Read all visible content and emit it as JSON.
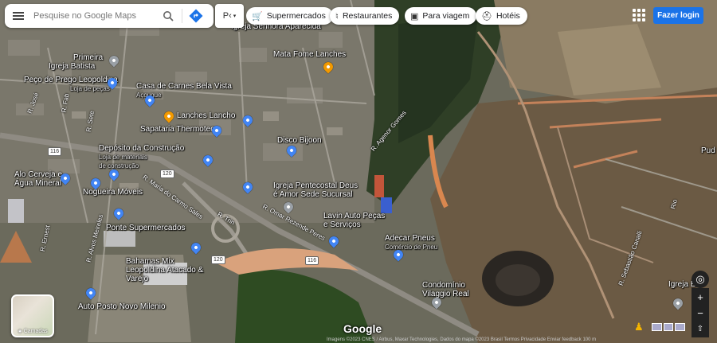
{
  "search": {
    "placeholder": "Pesquise no Google Maps"
  },
  "layer_select": {
    "label": "P‹"
  },
  "chips": [
    {
      "icon": "cart-icon",
      "label": "Supermercados"
    },
    {
      "icon": "fork-knife-icon",
      "label": "Restaurantes"
    },
    {
      "icon": "suitcase-icon",
      "label": "Para viagem"
    },
    {
      "icon": "bed-icon",
      "label": "Hotéis"
    }
  ],
  "header": {
    "login_label": "Fazer login"
  },
  "layers": {
    "label": "Camadas"
  },
  "places": [
    {
      "name": "Igreja Batista",
      "sub": "",
      "pin": "gray"
    },
    {
      "name": "Primeira",
      "sub": "",
      "pin": ""
    },
    {
      "name": "Peço de Prego Leopoldina",
      "sub": "Loja de peças",
      "pin": "blue"
    },
    {
      "name": "Casa de Carnes Bela Vista",
      "sub": "Açougue",
      "pin": "blue"
    },
    {
      "name": "Lanches Lancho",
      "sub": "",
      "pin": "orange"
    },
    {
      "name": "Sapataria Thermoteo",
      "sub": "",
      "pin": "blue"
    },
    {
      "name": "Mata Fome Lanches",
      "sub": "",
      "pin": "orange"
    },
    {
      "name": "Disco Bijoon",
      "sub": "",
      "pin": "blue"
    },
    {
      "name": "Depósito da Construção",
      "sub": "Loja de materiais de construção",
      "pin": "blue"
    },
    {
      "name": "Alo Cerveja e Água Mineral",
      "sub": "",
      "pin": "blue"
    },
    {
      "name": "Nogueira Móveis",
      "sub": "",
      "pin": "blue"
    },
    {
      "name": "Ponte Supermercados",
      "sub": "",
      "pin": "blue"
    },
    {
      "name": "Igreja Pentecostal Deus é Amor Sede Sucursal",
      "sub": "",
      "pin": "gray"
    },
    {
      "name": "Lavin Auto Peças e Serviços",
      "sub": "",
      "pin": "blue"
    },
    {
      "name": "Adecar Pneus",
      "sub": "Comércio de Pneu",
      "pin": "blue"
    },
    {
      "name": "Bahamas Mix Leopoldina Atacado & Varejo",
      "sub": "",
      "pin": "blue"
    },
    {
      "name": "Condomínio Vilaggio Real",
      "sub": "",
      "pin": "gray"
    },
    {
      "name": "Auto Posto Novo Milenio",
      "sub": "",
      "pin": "blue"
    },
    {
      "name": "Igreja Senhora Aparecida",
      "sub": "",
      "pin": "gray"
    },
    {
      "name": "Pud",
      "sub": "",
      "pin": ""
    },
    {
      "name": "Igreja E",
      "sub": "",
      "pin": ""
    }
  ],
  "shields": [
    "116",
    "120",
    "120",
    "116"
  ],
  "streets": [
    "R. Maria do Carmo Sales",
    "R. Omar Rezende Peres",
    "R. Agenor Gomes",
    "R. Alvos Meireles",
    "R. Trin",
    "R. José",
    "R. Fab",
    "R. Ernest",
    "R. Sebastião Canalli",
    "Rio",
    "R. Sete"
  ],
  "footer": {
    "logo": "Google",
    "attribution": "Imagens ©2023 CNES / Airbus, Maxar Technologies, Dados do mapa ©2023  Brasil  Termos  Privacidade  Enviar feedback  100 m"
  },
  "colors": {
    "accent": "#1a73e8",
    "pin_blue": "#4285f4",
    "pin_orange": "#f29900"
  }
}
